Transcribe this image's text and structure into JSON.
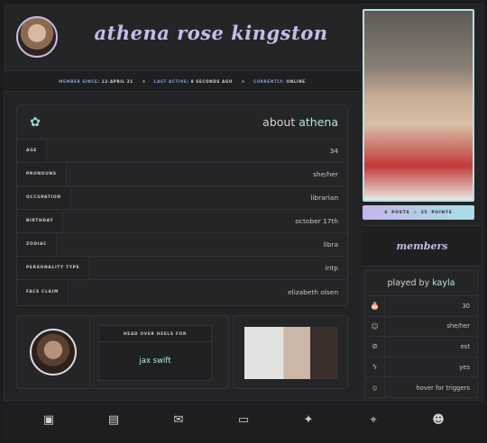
{
  "profile": {
    "name": "athena rose kingston",
    "meta": [
      {
        "label": "MEMBER SINCE:",
        "value": "12-APRIL 21"
      },
      {
        "label": "LAST ACTIVE:",
        "value": "8 SECONDS AGO"
      },
      {
        "label": "CURRENTLY:",
        "value": "ONLINE"
      }
    ]
  },
  "about": {
    "title_prefix": "about",
    "title_name": "athena",
    "rows": [
      {
        "label": "AGE",
        "value": "34"
      },
      {
        "label": "PRONOUNS",
        "value": "she/her"
      },
      {
        "label": "OCCUPATION",
        "value": "librarian"
      },
      {
        "label": "BIRTHDAY",
        "value": "october 17th"
      },
      {
        "label": "ZODIAC",
        "value": "libra"
      },
      {
        "label": "PERSONALITY TYPE",
        "value": "intp"
      },
      {
        "label": "FACE CLAIM",
        "value": "elizabeth olsen"
      }
    ]
  },
  "relationship": {
    "label": "HEAD OVER HEELS FOR",
    "name": "jax swift"
  },
  "sidebar": {
    "posts_count": "6",
    "posts_label": "POSTS",
    "points_count": "25",
    "points_label": "POINTS",
    "members_title": "members",
    "played_by_prefix": "played by",
    "played_by_name": "kayla",
    "player_rows": [
      {
        "icon": "cake-icon",
        "glyph": "🎂",
        "value": "30"
      },
      {
        "icon": "user-circle-icon",
        "glyph": "☺",
        "value": "she/her"
      },
      {
        "icon": "compass-icon",
        "glyph": "⊘",
        "value": "est"
      },
      {
        "icon": "lightning-icon",
        "glyph": "ϟ",
        "value": "yes"
      },
      {
        "icon": "slash-circle-icon",
        "glyph": "⦸",
        "value": "hover for triggers"
      }
    ]
  },
  "footer_icons": [
    {
      "icon": "archive-icon",
      "glyph": "▣"
    },
    {
      "icon": "passport-icon",
      "glyph": "▤"
    },
    {
      "icon": "mail-open-icon",
      "glyph": "✉"
    },
    {
      "icon": "id-card-icon",
      "glyph": "▭"
    },
    {
      "icon": "magic-wand-icon",
      "glyph": "✦"
    },
    {
      "icon": "map-pin-icon",
      "glyph": "⌖"
    },
    {
      "icon": "masks-icon",
      "glyph": "☻"
    }
  ]
}
